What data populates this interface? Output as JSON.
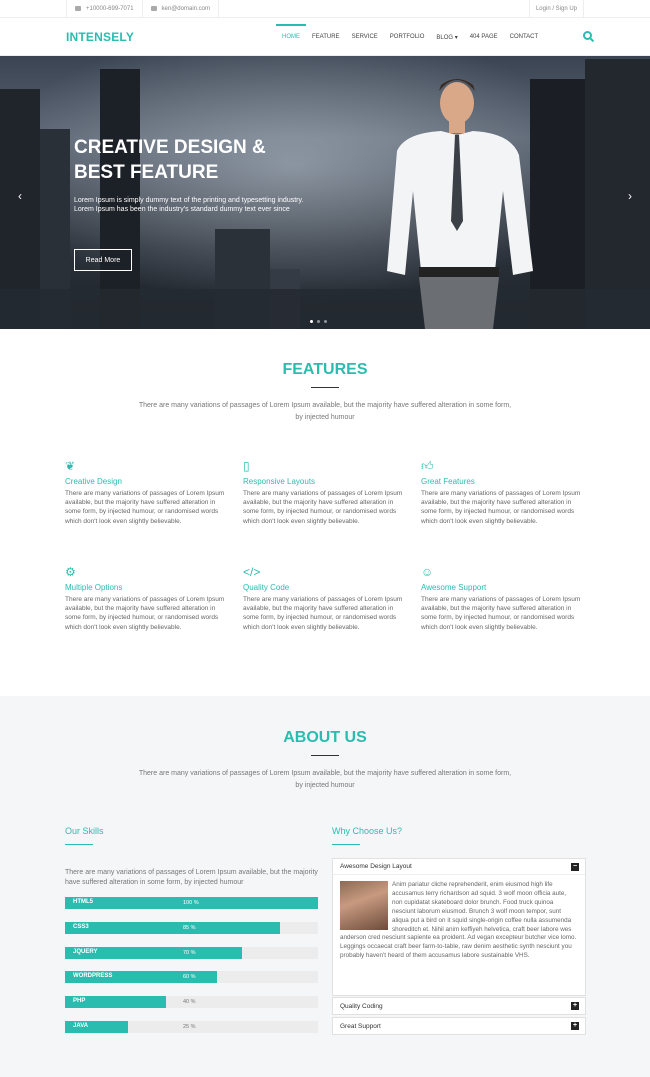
{
  "topbar": {
    "phone": "+10000-699-7071",
    "email": "ken@domain.com",
    "login": "Login / Sign Up"
  },
  "nav": {
    "logo": "INTENSELY",
    "items": [
      "HOME",
      "FEATURE",
      "SERVICE",
      "PORTFOLIO",
      "BLOG ▾",
      "404 PAGE",
      "CONTACT"
    ]
  },
  "hero": {
    "title_line1": "CREATIVE DESIGN &",
    "title_line2": "BEST FEATURE",
    "text": "Lorem Ipsum is simply dummy text of the printing and typesetting industry. Lorem Ipsum has been the industry's standard dummy text ever since",
    "button": "Read More"
  },
  "features": {
    "title": "FEATURES",
    "subtitle": "There are many variations of passages of Lorem Ipsum available, but the majority have suffered alteration in some form, by injected humour",
    "items": [
      {
        "icon": "leaf-icon",
        "title": "Creative Design",
        "desc": "There are many variations of passages of Lorem Ipsum available, but the majority have suffered alteration in some form, by injected humour, or randomised words which don't look even slightly believable."
      },
      {
        "icon": "mobile-icon",
        "title": "Responsive Layouts",
        "desc": "There are many variations of passages of Lorem Ipsum available, but the majority have suffered alteration in some form, by injected humour, or randomised words which don't look even slightly believable."
      },
      {
        "icon": "thumbs-up-icon",
        "title": "Great Features",
        "desc": "There are many variations of passages of Lorem Ipsum available, but the majority have suffered alteration in some form, by injected humour, or randomised words which don't look even slightly believable."
      },
      {
        "icon": "gears-icon",
        "title": "Multiple Options",
        "desc": "There are many variations of passages of Lorem Ipsum available, but the majority have suffered alteration in some form, by injected humour, or randomised words which don't look even slightly believable."
      },
      {
        "icon": "code-icon",
        "title": "Quality Code",
        "desc": "There are many variations of passages of Lorem Ipsum available, but the majority have suffered alteration in some form, by injected humour, or randomised words which don't look even slightly believable."
      },
      {
        "icon": "smile-icon",
        "title": "Awesome Support",
        "desc": "There are many variations of passages of Lorem Ipsum available, but the majority have suffered alteration in some form, by injected humour, or randomised words which don't look even slightly believable."
      }
    ]
  },
  "about": {
    "title": "ABOUT US",
    "subtitle": "There are many variations of passages of Lorem Ipsum available, but the majority have suffered alteration in some form, by injected humour",
    "skills_title": "Our Skills",
    "skills_text": "There are many variations of passages of Lorem Ipsum available, but the majority have suffered alteration in some form, by injected humour",
    "skills": [
      {
        "name": "HTML5",
        "percent": 100,
        "label": "100 %"
      },
      {
        "name": "CSS3",
        "percent": 85,
        "label": "85 %"
      },
      {
        "name": "JQUERY",
        "percent": 70,
        "label": "70 %"
      },
      {
        "name": "WORDPRESS",
        "percent": 60,
        "label": "60 %"
      },
      {
        "name": "PHP",
        "percent": 40,
        "label": "40 %"
      },
      {
        "name": "JAVA",
        "percent": 25,
        "label": "25 %"
      }
    ],
    "why_title": "Why Choose Us?",
    "accordion": [
      {
        "title": "Awesome Design Layout",
        "open": true,
        "body": "Anim pariatur cliche reprehenderit, enim eiusmod high life accusamus terry richardson ad squid. 3 wolf moon officia aute, non cupidatat skateboard dolor brunch. Food truck quinoa nesciunt laborum eiusmod. Brunch 3 wolf moon tempor, sunt aliqua put a bird on it squid single-origin coffee nulla assumenda shoreditch et. Nihil anim keffiyeh helvetica, craft beer labore wes anderson cred nesciunt sapiente ea proident. Ad vegan excepteur butcher vice lomo. Leggings occaecat craft beer farm-to-table, raw denim aesthetic synth nesciunt you probably haven't heard of them accusamus labore sustainable VHS."
      },
      {
        "title": "Quality Coding",
        "open": false
      },
      {
        "title": "Great Support",
        "open": false
      }
    ]
  },
  "colors": {
    "accent": "#2bbcb0"
  }
}
